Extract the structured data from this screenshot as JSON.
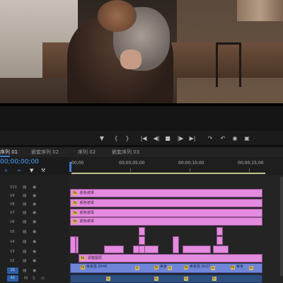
{
  "tabs": [
    {
      "label": "序列 01",
      "active": true
    },
    {
      "label": "嵌套序列 02",
      "active": false
    },
    {
      "label": "序列 02",
      "active": false
    },
    {
      "label": "嵌套序列 03",
      "active": false
    }
  ],
  "timecode": "00;00;00;00",
  "ruler": {
    "labels": [
      "00;00",
      "00;00;05;00",
      "00;00;10;00",
      "00;00;15;00"
    ]
  },
  "tracks": {
    "video": [
      "V10",
      "V9",
      "V8",
      "V7",
      "V6",
      "V5",
      "V4",
      "V3",
      "V2",
      "V1"
    ],
    "audio": [
      "A1"
    ]
  },
  "clips": {
    "adjustment_label": "颜色遮罩",
    "v2_label": "调整图层",
    "v1_clips": [
      "美食嘉 0048",
      "美食",
      "美食嘉 0027",
      "美食"
    ],
    "audio_label": "A1"
  },
  "transport": {
    "buttons": [
      "marker",
      "in",
      "out",
      "go-in",
      "step-back",
      "stop",
      "play",
      "step-forward",
      "go-out",
      "insert",
      "overwrite",
      "export-frame",
      "comparison"
    ]
  },
  "colors": {
    "timecode": "#4aa3ff",
    "adjustment_clip": "#e48be0",
    "video_clip": "#6f86d8",
    "audio_clip": "#2d4f80",
    "playhead": "#3d7bd6"
  }
}
